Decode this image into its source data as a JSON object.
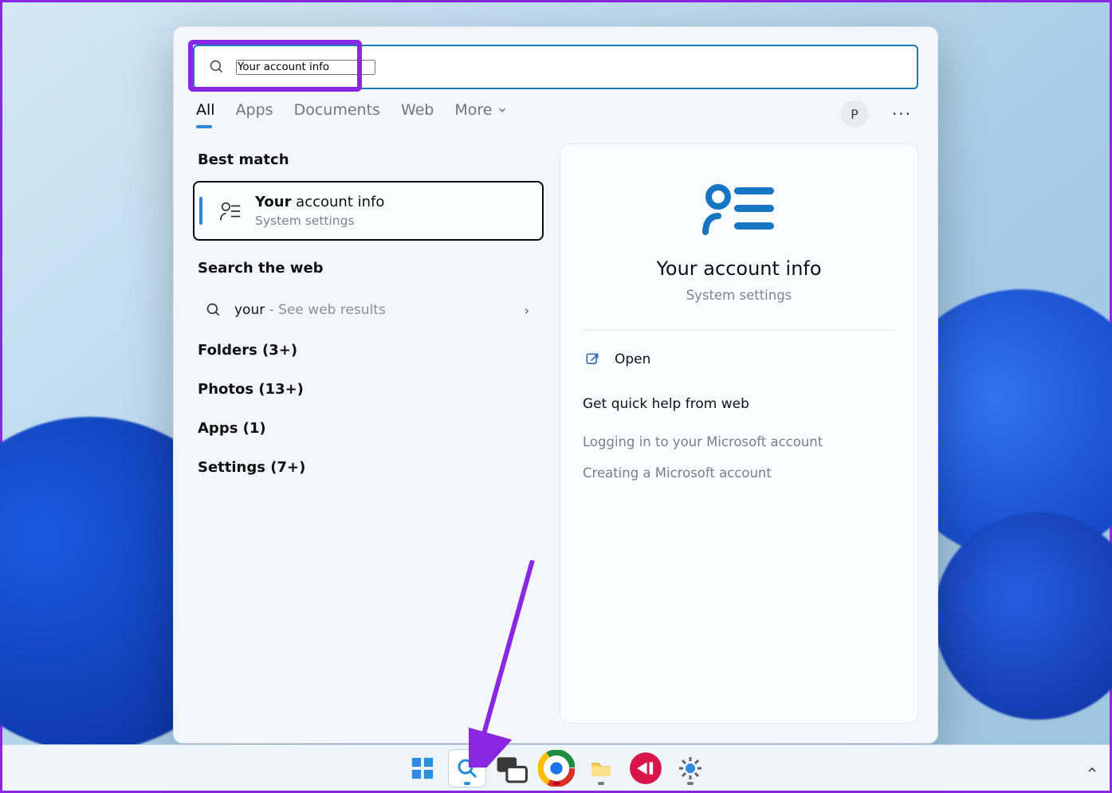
{
  "search": {
    "value": "Your account info"
  },
  "tabs": {
    "all": "All",
    "apps": "Apps",
    "documents": "Documents",
    "web": "Web",
    "more": "More"
  },
  "user_initial": "P",
  "sections": {
    "best_match": "Best match",
    "search_web": "Search the web"
  },
  "best": {
    "title_bold": "Your",
    "title_rest": " account info",
    "subtitle": "System settings"
  },
  "web": {
    "term": "your",
    "suffix": " - See web results"
  },
  "categories": {
    "folders": "Folders (3+)",
    "photos": "Photos (13+)",
    "apps": "Apps (1)",
    "settings": "Settings (7+)"
  },
  "detail": {
    "title": "Your account info",
    "subtitle": "System settings",
    "open": "Open",
    "help_head": "Get quick help from web",
    "help_links": {
      "0": "Logging in to your Microsoft account",
      "1": "Creating a Microsoft account"
    }
  }
}
